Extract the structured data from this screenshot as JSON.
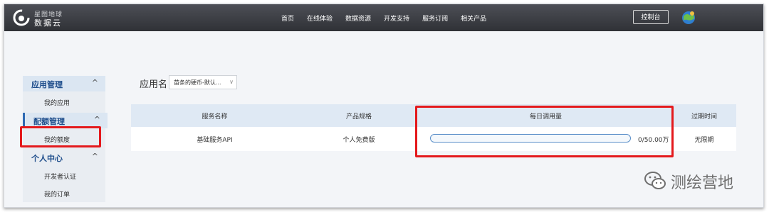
{
  "brand": {
    "line1": "星图地球",
    "line2": "数据云"
  },
  "nav": {
    "items": [
      "首页",
      "在线体验",
      "数据资源",
      "开发支持",
      "服务订阅",
      "相关产品"
    ],
    "console": "控制台"
  },
  "sidebar": {
    "sections": [
      {
        "label": "应用管理",
        "chevron": "^",
        "items": [
          "我的应用"
        ]
      },
      {
        "label": "配额管理",
        "chevron": "^",
        "items": [
          "我的额度"
        ]
      },
      {
        "label": "个人中心",
        "chevron": "^",
        "items": [
          "开发者认证",
          "我的订单"
        ]
      }
    ]
  },
  "app": {
    "label": "应用名",
    "selected": "苗条的硬币-默认...",
    "arrow": "∨"
  },
  "table": {
    "headers": [
      "服务名称",
      "产品规格",
      "每日调用量",
      "过期时间"
    ],
    "rows": [
      {
        "name": "基础服务API",
        "spec": "个人免费版",
        "usage_text": "0/50.00万",
        "usage_fraction": 0.0,
        "expire": "无限期"
      }
    ]
  },
  "watermark": {
    "text": "测绘营地"
  },
  "colors": {
    "topbar": "#3a3c42",
    "accent": "#2e6ab3",
    "highlight": "#e4191c",
    "header_bg": "#dfe9f4"
  }
}
